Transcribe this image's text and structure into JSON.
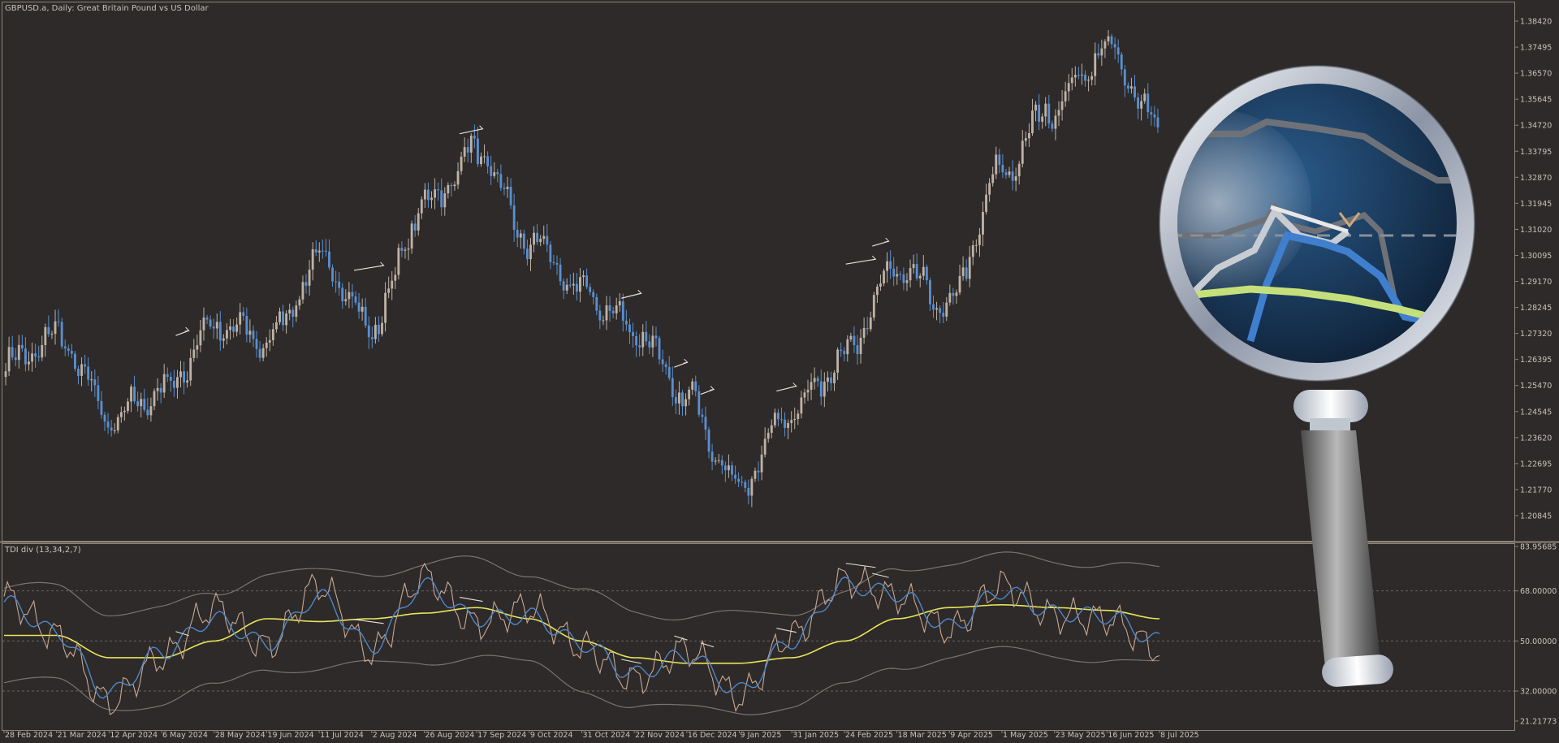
{
  "colors": {
    "background": "#2d2a29",
    "frame": "#8c8478",
    "bull_candle": "#bfb2a5",
    "bear_candle": "#5a8fd0",
    "text": "#c8c2ba",
    "rsi_line": "#c8a894",
    "signal_line": "#4f86c8",
    "market_base": "#e8e45a",
    "band_line": "#7a7470",
    "level_line": "#6a6460",
    "divergence": "#e6e2dc"
  },
  "main_chart": {
    "title": "GBPUSD.a, Daily:  Great Britain Pound vs US Dollar",
    "price_labels": [
      "1.38420",
      "1.37495",
      "1.36570",
      "1.35645",
      "1.34720",
      "1.33795",
      "1.32870",
      "1.31945",
      "1.31020",
      "1.30095",
      "1.29170",
      "1.28245",
      "1.27320",
      "1.26395",
      "1.25470",
      "1.24545",
      "1.23620",
      "1.22695",
      "1.21770",
      "1.20845"
    ],
    "ymax": 1.3842,
    "ymin": 1.20845
  },
  "indicator": {
    "title": "TDI div (13,34,2,7)",
    "level_labels": [
      "83.95685",
      "68.00000",
      "50.00000",
      "32.00000",
      "21.21773"
    ],
    "levels": [
      68,
      50,
      32
    ],
    "ymax": 83.95685,
    "ymin": 21.21773
  },
  "date_labels": [
    "28 Feb 2024",
    "21 Mar 2024",
    "12 Apr 2024",
    "6 May 2024",
    "28 May 2024",
    "19 Jun 2024",
    "11 Jul 2024",
    "2 Aug 2024",
    "26 Aug 2024",
    "17 Sep 2024",
    "9 Oct 2024",
    "31 Oct 2024",
    "22 Nov 2024",
    "16 Dec 2024",
    "9 Jan 2025",
    "31 Jan 2025",
    "24 Feb 2025",
    "18 Mar 2025",
    "9 Apr 2025",
    "1 May 2025",
    "23 May 2025",
    "16 Jun 2025",
    "8 Jul 2025"
  ],
  "icons": {
    "overlay": "magnifier-icon"
  },
  "chart_data": [
    {
      "type": "candlestick",
      "title": "GBPUSD.a, Daily:  Great Britain Pound vs US Dollar",
      "ylim": [
        1.20845,
        1.3842
      ],
      "x_range": [
        "28 Feb 2024",
        "8 Jul 2025"
      ],
      "close_path": [
        [
          "28 Feb 2024",
          1.262
        ],
        [
          "21 Mar 2024",
          1.272
        ],
        [
          "12 Apr 2024",
          1.243
        ],
        [
          "6 May 2024",
          1.253
        ],
        [
          "28 May 2024",
          1.276
        ],
        [
          "19 Jun 2024",
          1.271
        ],
        [
          "11 Jul 2024",
          1.299
        ],
        [
          "2 Aug 2024",
          1.276
        ],
        [
          "26 Aug 2024",
          1.319
        ],
        [
          "17 Sep 2024",
          1.338
        ],
        [
          "9 Oct 2024",
          1.306
        ],
        [
          "31 Oct 2024",
          1.288
        ],
        [
          "22 Nov 2024",
          1.275
        ],
        [
          "16 Dec 2024",
          1.25
        ],
        [
          "9 Jan 2025",
          1.219
        ],
        [
          "31 Jan 2025",
          1.246
        ],
        [
          "24 Feb 2025",
          1.265
        ],
        [
          "18 Mar 2025",
          1.296
        ],
        [
          "9 Apr 2025",
          1.283
        ],
        [
          "1 May 2025",
          1.33
        ],
        [
          "23 May 2025",
          1.354
        ],
        [
          "16 Jun 2025",
          1.374
        ],
        [
          "8 Jul 2025",
          1.348
        ]
      ]
    },
    {
      "type": "line",
      "title": "TDI div (13,34,2,7)",
      "ylim": [
        21.21773,
        83.95685
      ],
      "levels": [
        68,
        50,
        32
      ],
      "series": [
        {
          "values": [
            66,
            52,
            28,
            44,
            62,
            48,
            70,
            46,
            73,
            56,
            62,
            48,
            36,
            47,
            30,
            52,
            72,
            66,
            54,
            70,
            59,
            58,
            47
          ]
        },
        {
          "values": [
            64,
            53,
            31,
            46,
            58,
            49,
            66,
            48,
            70,
            58,
            59,
            49,
            38,
            45,
            32,
            50,
            70,
            67,
            55,
            68,
            60,
            59,
            50
          ]
        },
        {
          "values": [
            52,
            52,
            44,
            44,
            50,
            58,
            57,
            58,
            60,
            62,
            58,
            50,
            44,
            42,
            42,
            44,
            50,
            58,
            62,
            63,
            62,
            61,
            58
          ]
        }
      ]
    }
  ]
}
